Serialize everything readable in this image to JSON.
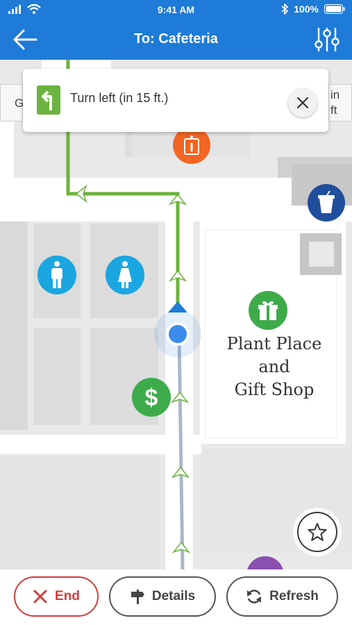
{
  "status_bar": {
    "time": "9:41 AM",
    "battery": "100%"
  },
  "header": {
    "title": "To: Cafeteria"
  },
  "direction_card": {
    "instruction": "Turn left (in 15 ft.)"
  },
  "peek_cards": {
    "left_text": "G",
    "right_line1": "in",
    "right_line2": "ft"
  },
  "map": {
    "shop_label_line1": "Plant Place",
    "shop_label_line2": "and",
    "shop_label_line3": "Gift Shop"
  },
  "bottom_bar": {
    "end_label": "End",
    "details_label": "Details",
    "refresh_label": "Refresh"
  },
  "colors": {
    "header": "#1e7bd8",
    "route": "#6db33f",
    "end": "#d23b3b",
    "restroom": "#1aa6e0",
    "money": "#3dab4a",
    "gift": "#3dab4a",
    "info": "#f26522",
    "coffee": "#1f4e9c"
  },
  "icons": [
    "back-arrow-icon",
    "sliders-icon",
    "turn-left-icon",
    "close-icon",
    "info-icon",
    "coffee-cup-icon",
    "men-restroom-icon",
    "women-restroom-icon",
    "gift-icon",
    "dollar-icon",
    "star-icon",
    "x-icon",
    "signpost-icon",
    "refresh-icon"
  ]
}
